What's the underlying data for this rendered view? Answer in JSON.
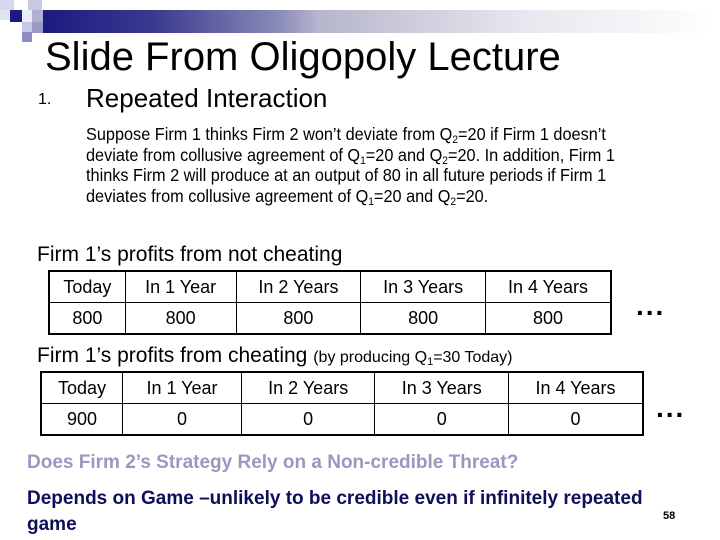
{
  "slide": {
    "title": "Slide From Oligopoly Lecture",
    "section_number": "1.",
    "section_heading": "Repeated Interaction",
    "paragraph": {
      "p1": "Suppose Firm 1 thinks Firm 2 won’t deviate from Q",
      "p1_sub": "2",
      "p2": "=20 if Firm 1 doesn’t deviate from collusive agreement of Q",
      "p2_sub": "1",
      "p3": "=20 and Q",
      "p3_sub": "2",
      "p4": "=20. In addition, Firm 1 thinks Firm 2 will produce at an output of 80 in all future periods if Firm 1 deviates from collusive agreement of Q",
      "p4_sub": "1",
      "p5": "=20 and Q",
      "p5_sub": "2",
      "p6": "=20."
    },
    "not_cheating": {
      "label": "Firm 1’s profits from not cheating",
      "headers": [
        "Today",
        "In 1 Year",
        "In 2 Years",
        "In 3 Years",
        "In 4 Years"
      ],
      "values": [
        "800",
        "800",
        "800",
        "800",
        "800"
      ],
      "ellipsis": "..."
    },
    "cheating": {
      "label": "Firm 1’s profits from cheating",
      "note_prefix": "(by producing Q",
      "note_sub": "1",
      "note_suffix": "=30 Today)",
      "headers": [
        "Today",
        "In 1 Year",
        "In 2 Years",
        "In 3 Years",
        "In 4 Years"
      ],
      "values": [
        "900",
        "0",
        "0",
        "0",
        "0"
      ],
      "ellipsis": "..."
    },
    "question": "Does Firm 2’s Strategy Rely on a Non-credible Threat?",
    "answer": "Depends on Game –unlikely to be credible even if infinitely repeated game",
    "page_number": "58"
  },
  "colors": {
    "accent_dark": "#1a1a80",
    "question_color": "#9999c0",
    "answer_color": "#0e0e5a"
  }
}
